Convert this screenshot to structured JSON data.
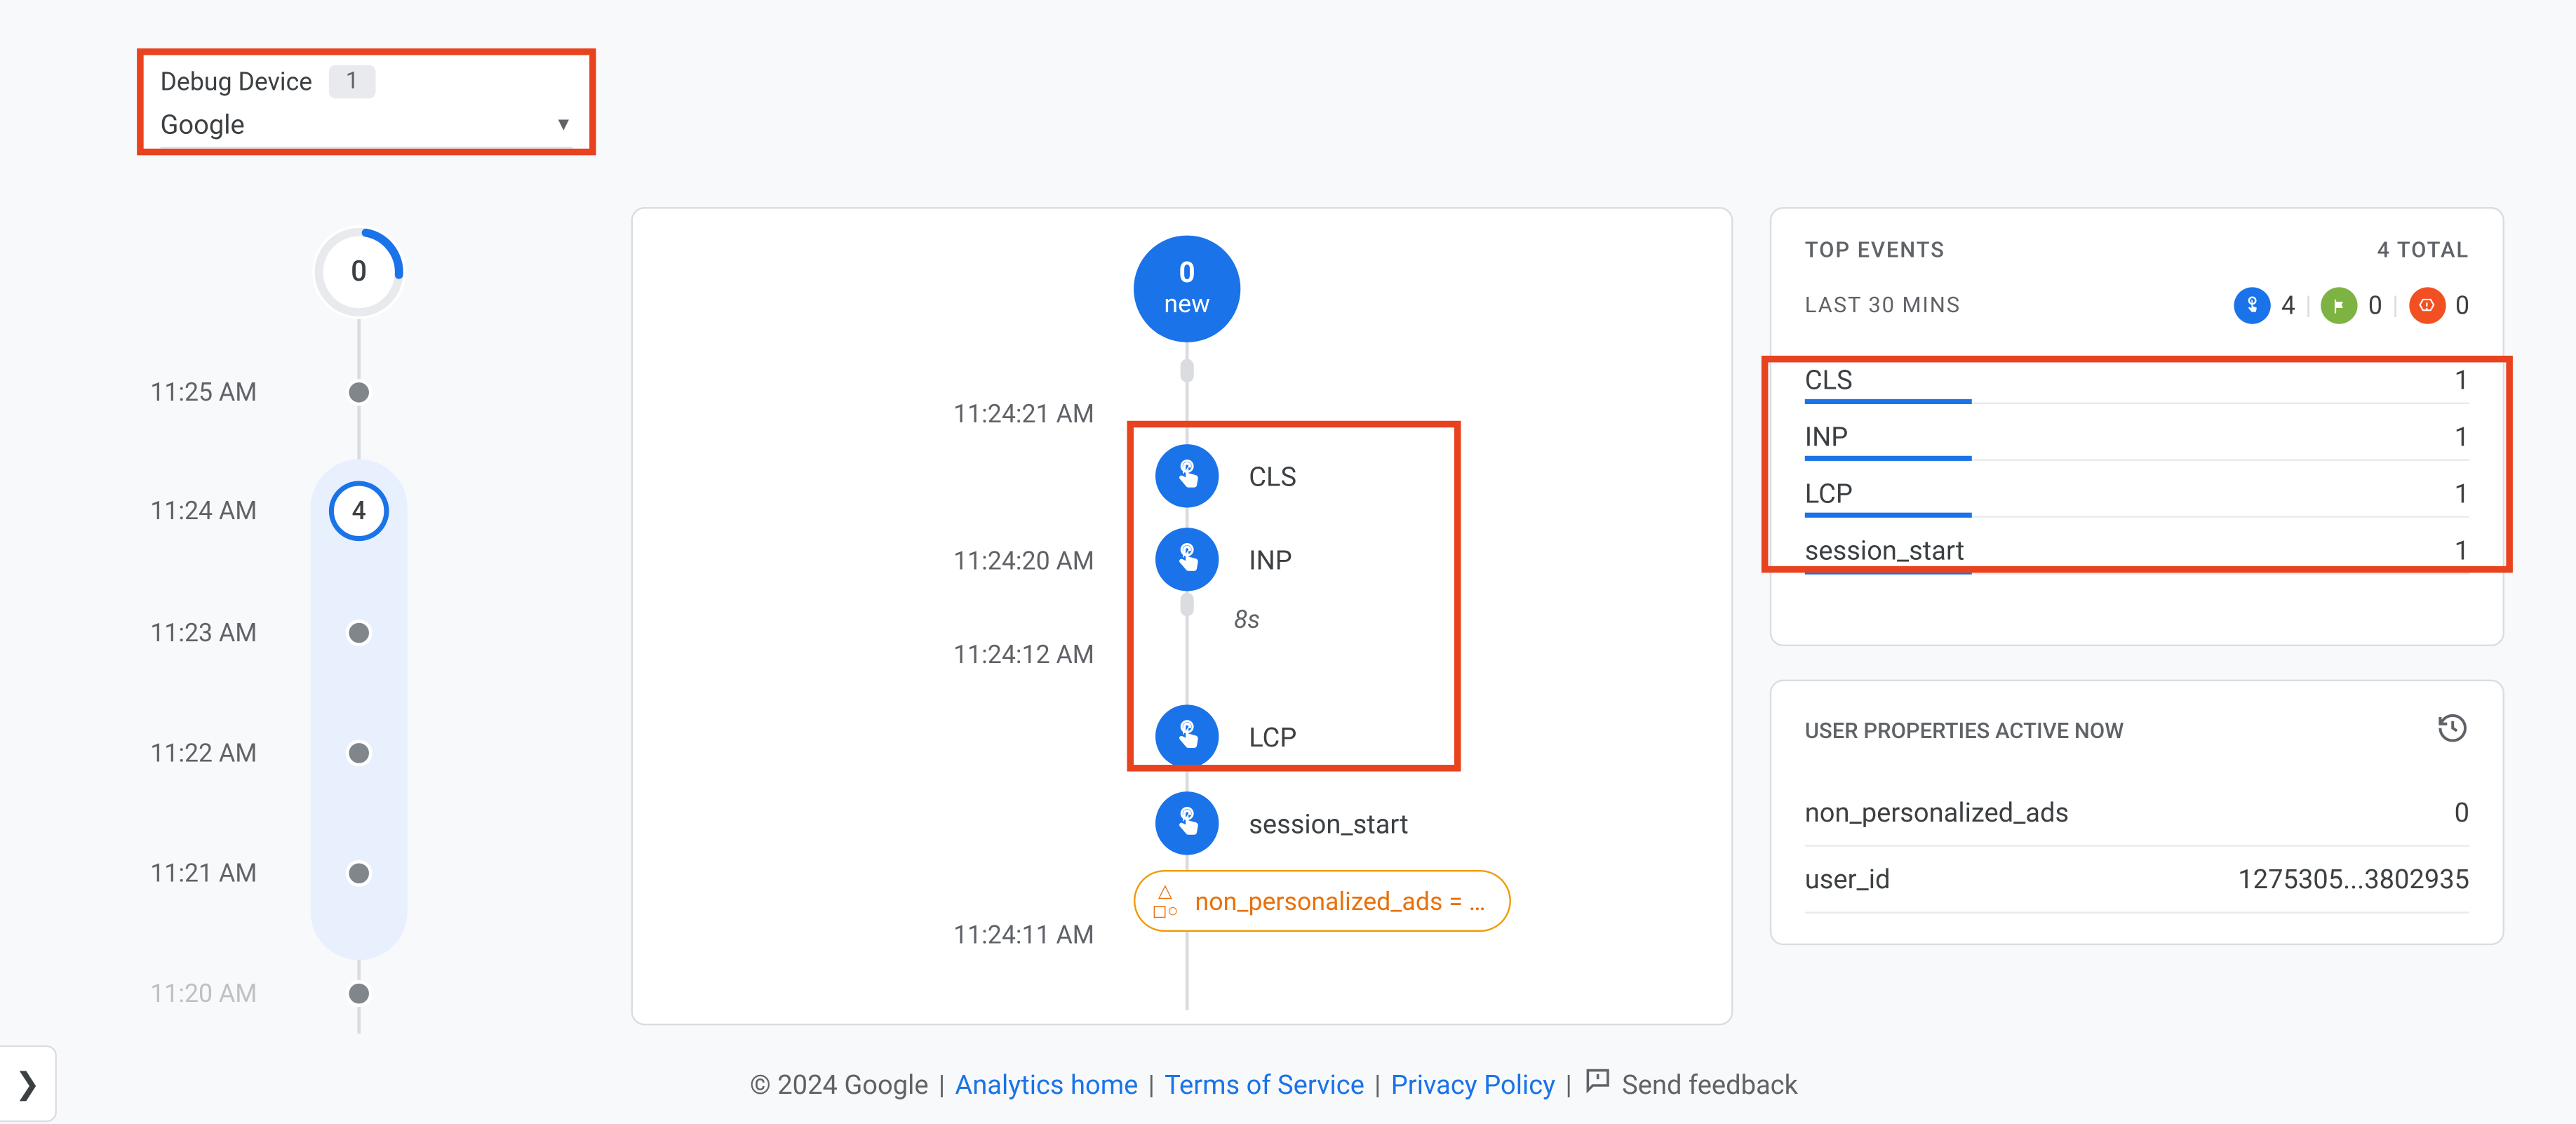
{
  "debugDevice": {
    "label": "Debug Device",
    "count": "1",
    "selected": "Google"
  },
  "miniTimeline": {
    "topCircleValue": "0",
    "stops": [
      {
        "time": "11:25 AM",
        "selected": false,
        "value": null,
        "fade": false
      },
      {
        "time": "11:24 AM",
        "selected": true,
        "value": "4",
        "fade": false
      },
      {
        "time": "11:23 AM",
        "selected": false,
        "value": null,
        "fade": false
      },
      {
        "time": "11:22 AM",
        "selected": false,
        "value": null,
        "fade": false
      },
      {
        "time": "11:21 AM",
        "selected": false,
        "value": null,
        "fade": false
      },
      {
        "time": "11:20 AM",
        "selected": false,
        "value": null,
        "fade": true
      }
    ]
  },
  "detail": {
    "bubble": {
      "num": "0",
      "label": "new"
    },
    "times": {
      "t1": "11:24:21 AM",
      "t2": "11:24:20 AM",
      "t3": "11:24:12 AM",
      "t4": "11:24:11 AM"
    },
    "gap": "8s",
    "events": {
      "cls": "CLS",
      "inp": "INP",
      "lcp": "LCP",
      "session_start": "session_start"
    },
    "orangePill": "non_personalized_ads = …"
  },
  "topEvents": {
    "title": "TOP EVENTS",
    "totalLabel": "4 TOTAL",
    "subtitle": "LAST 30 MINS",
    "iconCounts": {
      "touch": "4",
      "flag": "0",
      "error": "0"
    },
    "rows": [
      {
        "name": "CLS",
        "count": "1",
        "bar": 25
      },
      {
        "name": "INP",
        "count": "1",
        "bar": 25
      },
      {
        "name": "LCP",
        "count": "1",
        "bar": 25
      },
      {
        "name": "session_start",
        "count": "1",
        "bar": 25
      }
    ]
  },
  "userProps": {
    "title": "USER PROPERTIES ACTIVE NOW",
    "rows": [
      {
        "name": "non_personalized_ads",
        "value": "0"
      },
      {
        "name": "user_id",
        "value": "1275305...3802935"
      }
    ]
  },
  "footer": {
    "copyright": "© 2024 Google",
    "links": {
      "analyticsHome": "Analytics home",
      "tos": "Terms of Service",
      "privacy": "Privacy Policy"
    },
    "feedback": "Send feedback"
  }
}
